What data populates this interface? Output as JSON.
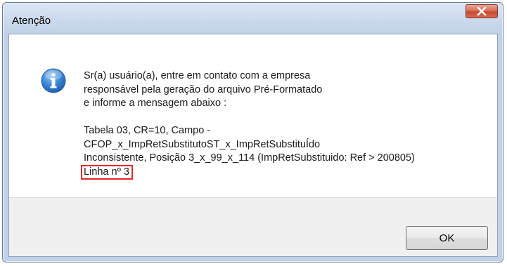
{
  "window": {
    "title": "Atenção",
    "close_glyph": "X"
  },
  "dialog": {
    "icon": "info-icon",
    "lines": [
      "Sr(a) usuário(a), entre em contato com a empresa",
      "responsável pela geração do arquivo Pré-Formatado",
      "e informe a mensagem abaixo :"
    ],
    "details": [
      "Tabela 03, CR=10, Campo -",
      "CFOP_x_ImpRetSubstitutoST_x_ImpRetSubstituÍdo",
      "Inconsistente, Posição 3_x_99_x_114 (ImpRetSubstituido: Ref > 200805)"
    ],
    "highlighted_line": "Linha nº 3"
  },
  "buttons": {
    "ok_label": "OK"
  },
  "colors": {
    "highlight_border": "#e8262b",
    "close_button": "#c44a34",
    "icon_blue": "#2a6fc0"
  }
}
